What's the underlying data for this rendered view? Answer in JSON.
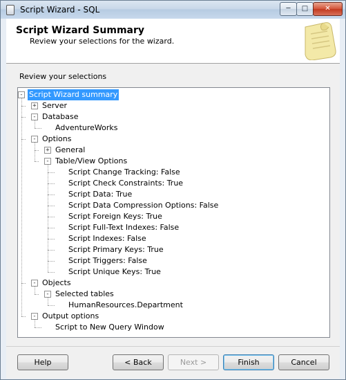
{
  "window": {
    "title": "Script Wizard - SQL",
    "controls": {
      "minimize": "─",
      "maximize": "□",
      "close": "✕"
    }
  },
  "header": {
    "title": "Script Wizard Summary",
    "subtitle": "Review your selections for the wizard."
  },
  "review_label": "Review your selections",
  "tree": [
    {
      "label": "Script Wizard summary",
      "depth": 0,
      "expander": "-",
      "selected": true,
      "last": true
    },
    {
      "label": "Server",
      "depth": 1,
      "expander": "+"
    },
    {
      "label": "Database",
      "depth": 1,
      "expander": "-"
    },
    {
      "label": "AdventureWorks",
      "depth": 2,
      "expander": null,
      "last": true
    },
    {
      "label": "Options",
      "depth": 1,
      "expander": "-"
    },
    {
      "label": "General",
      "depth": 2,
      "expander": "+"
    },
    {
      "label": "Table/View Options",
      "depth": 2,
      "expander": "-",
      "last": true
    },
    {
      "label": "Script Change Tracking: False",
      "depth": 3,
      "expander": null
    },
    {
      "label": "Script Check Constraints: True",
      "depth": 3,
      "expander": null
    },
    {
      "label": "Script Data: True",
      "depth": 3,
      "expander": null
    },
    {
      "label": "Script Data Compression Options: False",
      "depth": 3,
      "expander": null
    },
    {
      "label": "Script Foreign Keys: True",
      "depth": 3,
      "expander": null
    },
    {
      "label": "Script Full-Text Indexes: False",
      "depth": 3,
      "expander": null
    },
    {
      "label": "Script Indexes: False",
      "depth": 3,
      "expander": null
    },
    {
      "label": "Script Primary Keys: True",
      "depth": 3,
      "expander": null
    },
    {
      "label": "Script Triggers: False",
      "depth": 3,
      "expander": null
    },
    {
      "label": "Script Unique Keys: True",
      "depth": 3,
      "expander": null,
      "last": true
    },
    {
      "label": "Objects",
      "depth": 1,
      "expander": "-"
    },
    {
      "label": "Selected tables",
      "depth": 2,
      "expander": "-",
      "last": true
    },
    {
      "label": "HumanResources.Department",
      "depth": 3,
      "expander": null,
      "last": true
    },
    {
      "label": "Output options",
      "depth": 1,
      "expander": "-",
      "last": true
    },
    {
      "label": "Script to New Query Window",
      "depth": 2,
      "expander": null,
      "last": true
    }
  ],
  "buttons": {
    "help": "Help",
    "back": "< Back",
    "next": "Next >",
    "finish": "Finish",
    "cancel": "Cancel"
  }
}
